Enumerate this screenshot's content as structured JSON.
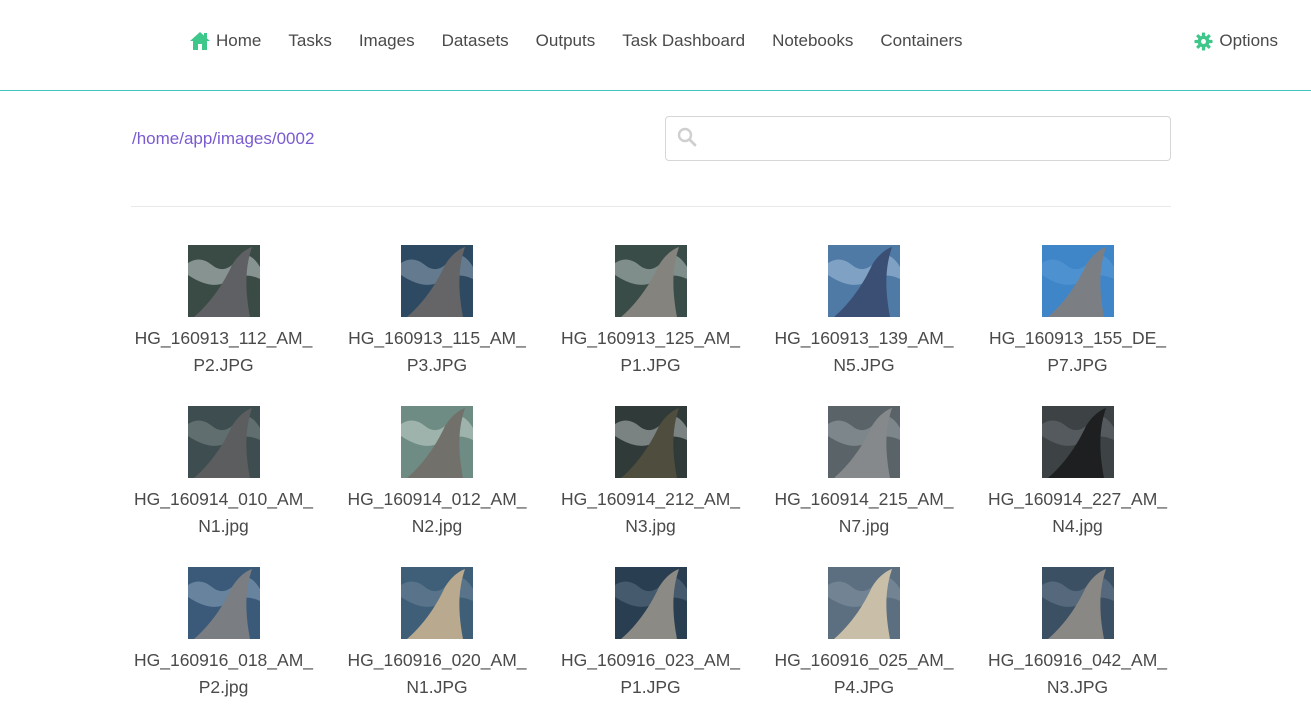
{
  "nav": {
    "items": [
      {
        "label": "Home",
        "icon": "home-icon"
      },
      {
        "label": "Tasks"
      },
      {
        "label": "Images"
      },
      {
        "label": "Datasets"
      },
      {
        "label": "Outputs"
      },
      {
        "label": "Task Dashboard"
      },
      {
        "label": "Notebooks"
      },
      {
        "label": "Containers"
      }
    ],
    "options_label": "Options",
    "accent_color": "#3ec78a",
    "border_color": "#3ec7c2"
  },
  "path": "/home/app/images/0002",
  "search": {
    "value": "",
    "placeholder": ""
  },
  "images": [
    {
      "name_line1": "HG_160913_112_AM_",
      "name_line2": "P2.JPG",
      "bg": "#3a4a44",
      "fin": "#5f6063",
      "water": "#c7cfd0"
    },
    {
      "name_line1": "HG_160913_115_AM_",
      "name_line2": "P3.JPG",
      "bg": "#2e4a63",
      "fin": "#656466",
      "water": "#8fa3b4"
    },
    {
      "name_line1": "HG_160913_125_AM_",
      "name_line2": "P1.JPG",
      "bg": "#3a4c48",
      "fin": "#85837d",
      "water": "#b9c5c2"
    },
    {
      "name_line1": "HG_160913_139_AM_",
      "name_line2": "N5.JPG",
      "bg": "#4f7aa6",
      "fin": "#3a4f73",
      "water": "#a7c2dc"
    },
    {
      "name_line1": "HG_160913_155_DE_",
      "name_line2": "P7.JPG",
      "bg": "#3f86c9",
      "fin": "#7b7f84",
      "water": "#5a9ad6"
    },
    {
      "name_line1": "HG_160914_010_AM_",
      "name_line2": "N1.jpg",
      "bg": "#3e4d4f",
      "fin": "#5b5d5f",
      "water": "#7c8a8c"
    },
    {
      "name_line1": "HG_160914_012_AM_",
      "name_line2": "N2.jpg",
      "bg": "#6e8c84",
      "fin": "#72706b",
      "water": "#c8d4d0"
    },
    {
      "name_line1": "HG_160914_212_AM_",
      "name_line2": "N3.jpg",
      "bg": "#2f3a39",
      "fin": "#4f4d3d",
      "water": "#b8c0bf"
    },
    {
      "name_line1": "HG_160914_215_AM_",
      "name_line2": "N7.jpg",
      "bg": "#5a6468",
      "fin": "#86898b",
      "water": "#9aa3a6"
    },
    {
      "name_line1": "HG_160914_227_AM_",
      "name_line2": "N4.jpg",
      "bg": "#3d4245",
      "fin": "#1d1f20",
      "water": "#6a7073"
    },
    {
      "name_line1": "HG_160916_018_AM_",
      "name_line2": "P2.jpg",
      "bg": "#3b5a7a",
      "fin": "#7a7e82",
      "water": "#8ea6bc"
    },
    {
      "name_line1": "HG_160916_020_AM_",
      "name_line2": "N1.JPG",
      "bg": "#3f5f78",
      "fin": "#b9a98e",
      "water": "#6d8399"
    },
    {
      "name_line1": "HG_160916_023_AM_",
      "name_line2": "P1.JPG",
      "bg": "#2a3e52",
      "fin": "#8c8a85",
      "water": "#5d7185"
    },
    {
      "name_line1": "HG_160916_025_AM_",
      "name_line2": "P4.JPG",
      "bg": "#5b6f80",
      "fin": "#c9bfa8",
      "water": "#8596a4"
    },
    {
      "name_line1": "HG_160916_042_AM_",
      "name_line2": "N3.JPG",
      "bg": "#3c5064",
      "fin": "#8a8884",
      "water": "#6b7d8f"
    }
  ]
}
